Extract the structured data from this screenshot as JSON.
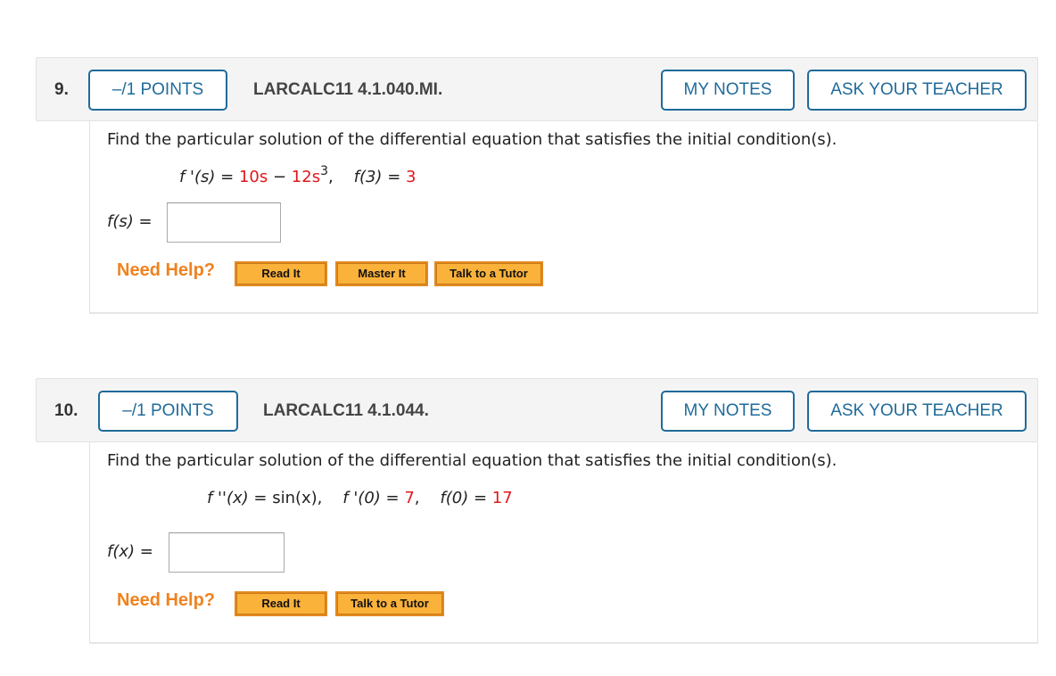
{
  "questions": [
    {
      "number": "9.",
      "points_label": "–/1 POINTS",
      "code": "LARCALC11 4.1.040.MI.",
      "my_notes_label": "MY NOTES",
      "ask_teacher_label": "ASK YOUR TEACHER",
      "prompt": "Find the particular solution of the differential equation that satisfies the initial condition(s).",
      "equation": {
        "lhs": "f '(s)",
        "equals": " = ",
        "term1": "10s",
        "minus": " − ",
        "term2_coef": "12s",
        "term2_exp": "3",
        "sep": ",    ",
        "cond_lhs": "f(3)",
        "cond_eq": " = ",
        "cond_val": "3"
      },
      "answer_label": "f(s)",
      "answer_equals": " = ",
      "answer_value": "",
      "need_help_label": "Need Help?",
      "help_buttons": [
        "Read It",
        "Master It",
        "Talk to a Tutor"
      ]
    },
    {
      "number": "10.",
      "points_label": "–/1 POINTS",
      "code": "LARCALC11 4.1.044.",
      "my_notes_label": "MY NOTES",
      "ask_teacher_label": "ASK YOUR TEACHER",
      "prompt": "Find the particular solution of the differential equation that satisfies the initial condition(s).",
      "equation": {
        "lhs": "f ''(x)",
        "equals": " = ",
        "rhs": "sin(x),",
        "sep": "    ",
        "cond1_lhs": "f '(0)",
        "cond1_eq": " = ",
        "cond1_val": "7",
        "cond1_comma": ",",
        "cond2_lhs": "f(0)",
        "cond2_eq": " = ",
        "cond2_val": "17"
      },
      "answer_label": "f(x)",
      "answer_equals": " = ",
      "answer_value": "",
      "need_help_label": "Need Help?",
      "help_buttons": [
        "Read It",
        "Talk to a Tutor"
      ]
    }
  ],
  "colors": {
    "accent": "#1f6b9a",
    "highlight_red": "#e0191c",
    "need_help_orange": "#f0821e",
    "help_button_fill": "#fbb23b"
  }
}
